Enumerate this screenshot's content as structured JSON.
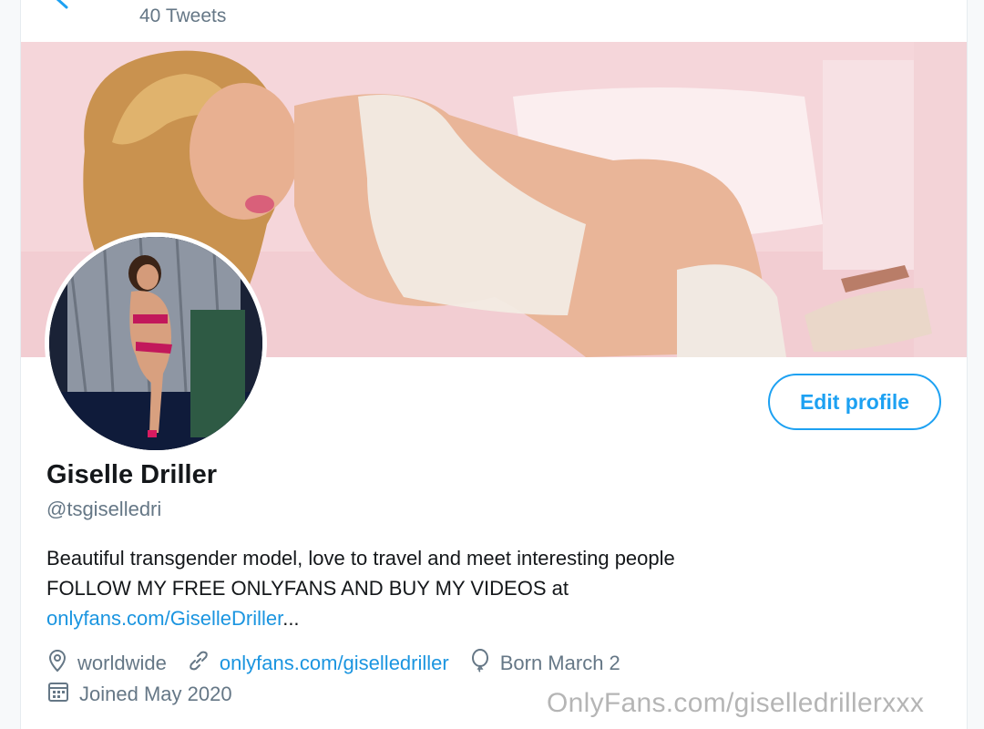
{
  "header": {
    "tweet_count": "40 Tweets",
    "back_icon": "arrow-left-icon"
  },
  "banner": {
    "description_icon": "profile-banner-photo"
  },
  "avatar": {
    "description_icon": "profile-avatar-photo"
  },
  "actions": {
    "edit_profile_label": "Edit profile"
  },
  "profile": {
    "display_name": "Giselle Driller",
    "handle": "@tsgiselledri",
    "bio_line1": "Beautiful transgender model, love to travel and meet interesting people",
    "bio_line2": "FOLLOW MY FREE ONLYFANS AND BUY MY VIDEOS at",
    "bio_link": "onlyfans.com/GiselleDriller",
    "bio_ellipsis": "..."
  },
  "meta": {
    "location": "worldwide",
    "website": "onlyfans.com/giselledriller",
    "birthday": "Born March 2",
    "joined": "Joined May 2020"
  },
  "watermark": "OnlyFans.com/giselledrillerxxx",
  "colors": {
    "accent": "#1da1f2",
    "link": "#1b95e0",
    "secondary_text": "#657786",
    "primary_text": "#14171a"
  }
}
